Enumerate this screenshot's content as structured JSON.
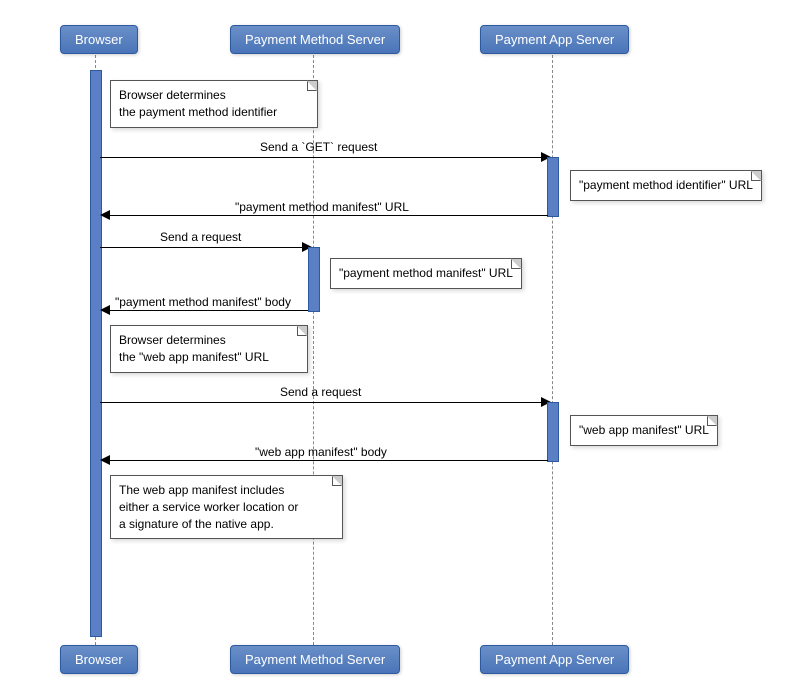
{
  "participants": {
    "browser": "Browser",
    "pms": "Payment Method Server",
    "pas": "Payment App Server"
  },
  "notes": {
    "n1_line1": "Browser determines",
    "n1_line2": "the payment method identifier",
    "n2": "\"payment method identifier\" URL",
    "n3": "\"payment method manifest\" URL",
    "n4_line1": "Browser determines",
    "n4_line2": "the \"web app manifest\" URL",
    "n5": "\"web app manifest\" URL",
    "n6_line1": "The web app manifest includes",
    "n6_line2": "either a service worker location or",
    "n6_line3": "a signature of the native app."
  },
  "messages": {
    "m1": "Send a `GET` request",
    "m2": "\"payment method manifest\" URL",
    "m3": "Send a request",
    "m4": "\"payment method manifest\" body",
    "m5": "Send a request",
    "m6": "\"web app manifest\" body"
  }
}
